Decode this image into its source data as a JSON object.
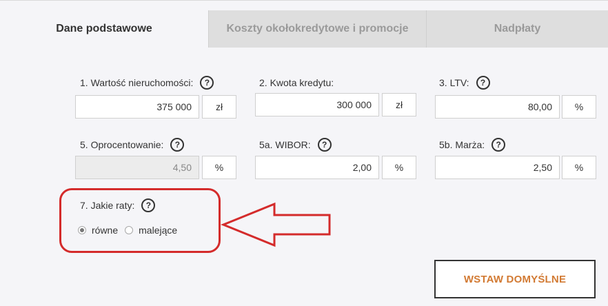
{
  "tabs": [
    {
      "label": "Dane podstawowe",
      "active": true
    },
    {
      "label": "Koszty okołokredytowe i promocje",
      "active": false
    },
    {
      "label": "Nadpłaty",
      "active": false
    }
  ],
  "help_glyph": "?",
  "fields": {
    "property_value": {
      "label": "1. Wartość nieruchomości:",
      "value": "375 000",
      "unit": "zł"
    },
    "loan_amount": {
      "label": "2. Kwota kredytu:",
      "value": "300 000",
      "unit": "zł"
    },
    "ltv": {
      "label": "3. LTV:",
      "value": "80,00",
      "unit": "%"
    },
    "interest_rate": {
      "label": "5. Oprocentowanie:",
      "value": "4,50",
      "unit": "%"
    },
    "wibor": {
      "label": "5a. WIBOR:",
      "value": "2,00",
      "unit": "%"
    },
    "margin": {
      "label": "5b. Marża:",
      "value": "2,50",
      "unit": "%"
    }
  },
  "installments": {
    "label": "7. Jakie raty:",
    "options": [
      {
        "label": "równe",
        "selected": true
      },
      {
        "label": "malejące",
        "selected": false
      }
    ]
  },
  "defaults_button": {
    "label": "WSTAW DOMYŚLNE"
  },
  "colors": {
    "highlight": "#d42b2b",
    "cta_text": "#d27a33"
  }
}
